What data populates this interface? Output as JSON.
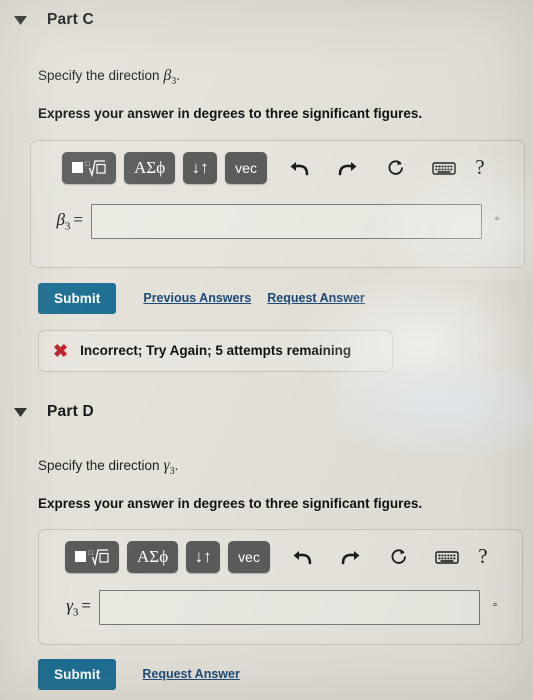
{
  "parts": [
    {
      "id": "part-c",
      "title": "Part C",
      "caret_icon": "caret-down-icon",
      "prompt_prefix": "Specify the direction",
      "prompt_symbol": "β",
      "prompt_subscript": "3",
      "prompt_suffix": ".",
      "instruction": "Express your answer in degrees to three significant figures.",
      "toolbar": {
        "template_label": "√",
        "template_icon": "math-template-icon",
        "greek_label": "ΑΣϕ",
        "arrows_label": "↓↑",
        "vec_label": "vec",
        "undo_icon": "undo-icon",
        "redo_icon": "redo-icon",
        "reset_icon": "reset-icon",
        "keyboard_icon": "keyboard-icon",
        "help_label": "?"
      },
      "answer": {
        "label_symbol": "β",
        "label_subscript": "3",
        "equals": "=",
        "value": "",
        "placeholder": "",
        "unit": "°"
      },
      "actions": {
        "submit_label": "Submit",
        "previous_answers_label": "Previous Answers",
        "request_answer_label": "Request Answer"
      },
      "feedback": {
        "icon": "red-x-icon",
        "text": "Incorrect; Try Again; 5 attempts remaining",
        "icon_color": "#c0202a"
      }
    },
    {
      "id": "part-d",
      "title": "Part D",
      "caret_icon": "caret-down-icon",
      "prompt_prefix": "Specify the direction",
      "prompt_symbol": "γ",
      "prompt_subscript": "3",
      "prompt_suffix": ".",
      "instruction": "Express your answer in degrees to three significant figures.",
      "toolbar": {
        "template_label": "√",
        "template_icon": "math-template-icon",
        "greek_label": "ΑΣϕ",
        "arrows_label": "↓↑",
        "vec_label": "vec",
        "undo_icon": "undo-icon",
        "redo_icon": "redo-icon",
        "reset_icon": "reset-icon",
        "keyboard_icon": "keyboard-icon",
        "help_label": "?"
      },
      "answer": {
        "label_symbol": "γ",
        "label_subscript": "3",
        "equals": "=",
        "value": "",
        "placeholder": "",
        "unit": "°"
      },
      "actions": {
        "submit_label": "Submit",
        "request_answer_label": "Request Answer"
      }
    }
  ],
  "colors": {
    "submit_blue": "#1b6d92",
    "link_blue": "#1b4a77",
    "toolbar_button_gray": "#5b5b5b",
    "page_background": "#e4e1d9",
    "error_red": "#c0202a"
  }
}
